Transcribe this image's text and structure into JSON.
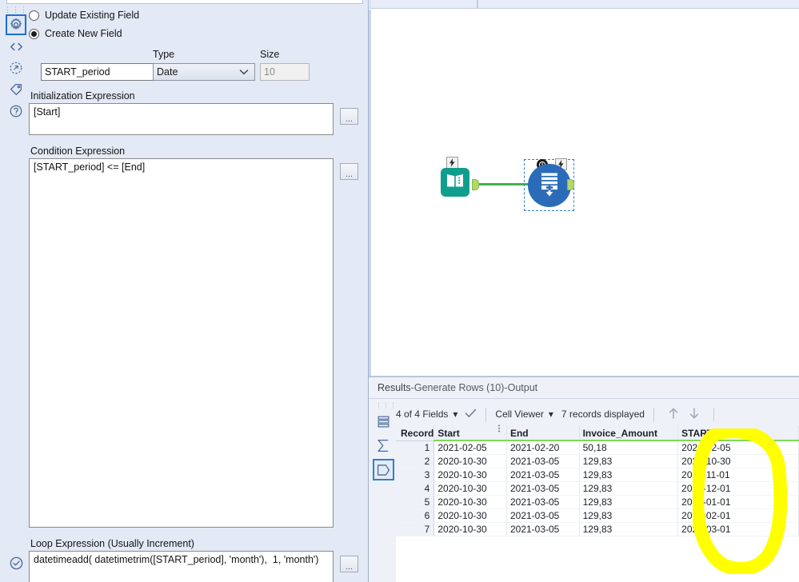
{
  "config": {
    "rail_icons": [
      {
        "name": "gear-icon",
        "label": "Configuration",
        "selected": true
      },
      {
        "name": "code-icon",
        "label": "Annotation Code",
        "selected": false
      },
      {
        "name": "arrow-circle-icon",
        "label": "Run",
        "selected": false
      },
      {
        "name": "tag-icon",
        "label": "Annotation",
        "selected": false
      },
      {
        "name": "help-icon",
        "label": "Help",
        "selected": false
      }
    ],
    "bottom_icon": {
      "name": "check-circle-icon",
      "label": "Valid"
    },
    "radios": [
      {
        "label": "Update Existing Field",
        "checked": false
      },
      {
        "label": "Create New  Field",
        "checked": true
      }
    ],
    "field_name": {
      "label": "",
      "value": "START_period"
    },
    "type": {
      "label": "Type",
      "value": "Date"
    },
    "size": {
      "label": "Size",
      "value": "10",
      "disabled": true
    },
    "initialization": {
      "label": "Initialization Expression",
      "value": "[Start]",
      "button": "..."
    },
    "condition": {
      "label": "Condition Expression",
      "value": "[START_period] <= [End]",
      "button": "..."
    },
    "loop": {
      "label": "Loop Expression (Usually Increment)",
      "value": "datetimeadd( datetimetrim([START_period], 'month'),  1, 'month')",
      "button": "..."
    }
  },
  "canvas": {
    "nodes": [
      {
        "name": "text-input-node",
        "type": "Text Input",
        "color": "#0f9e8e"
      },
      {
        "name": "generate-rows-node",
        "type": "Generate Rows",
        "color": "#2b6cb8",
        "selected": true
      }
    ],
    "connection_color": "#3cb44a"
  },
  "results": {
    "title_prefix": "Results",
    "title_sep1": " - ",
    "title_node": "Generate Rows (10)",
    "title_sep2": " - ",
    "title_output": "Output",
    "title_full": "Results - Generate Rows (10) - Output",
    "rail_icons": [
      {
        "name": "table-rows-icon",
        "label": "Data",
        "selected": false
      },
      {
        "name": "sigma-icon",
        "label": "Profile",
        "selected": false
      },
      {
        "name": "pentagon-icon",
        "label": "Metadata",
        "selected": true
      }
    ],
    "toolbar": {
      "fields_label": "4 of 4 Fields",
      "fields_caret": "▾",
      "check_icon": "✓",
      "viewer_label": "Cell Viewer",
      "viewer_caret": "▾",
      "records_label": "7 records displayed",
      "arrow_up": "↑",
      "arrow_down": "↓"
    },
    "grid": {
      "columns": [
        "Record",
        "Start",
        "End",
        "Invoice_Amount",
        "START_period"
      ],
      "rows": [
        {
          "record": "1",
          "start": "2021-02-05",
          "end": "2021-02-20",
          "amount": "50,18",
          "period": "2021-02-05"
        },
        {
          "record": "2",
          "start": "2020-10-30",
          "end": "2021-03-05",
          "amount": "129,83",
          "period": "2020-10-30"
        },
        {
          "record": "3",
          "start": "2020-10-30",
          "end": "2021-03-05",
          "amount": "129,83",
          "period": "2020-11-01"
        },
        {
          "record": "4",
          "start": "2020-10-30",
          "end": "2021-03-05",
          "amount": "129,83",
          "period": "2020-12-01"
        },
        {
          "record": "5",
          "start": "2020-10-30",
          "end": "2021-03-05",
          "amount": "129,83",
          "period": "2021-01-01"
        },
        {
          "record": "6",
          "start": "2020-10-30",
          "end": "2021-03-05",
          "amount": "129,83",
          "period": "2021-02-01"
        },
        {
          "record": "7",
          "start": "2020-10-30",
          "end": "2021-03-05",
          "amount": "129,83",
          "period": "2021-03-01"
        }
      ]
    }
  },
  "annotation": {
    "name": "yellow-highlight-circle",
    "color": "#ffff00",
    "targets": "START_period column"
  },
  "colors": {
    "panel_bg": "#e3e9f5",
    "accent_blue": "#2f7fd0",
    "node_teal": "#0f9e8e",
    "node_blue": "#2b6cb8",
    "grid_green": "#7ed957",
    "highlight_yellow": "#ffff00"
  }
}
